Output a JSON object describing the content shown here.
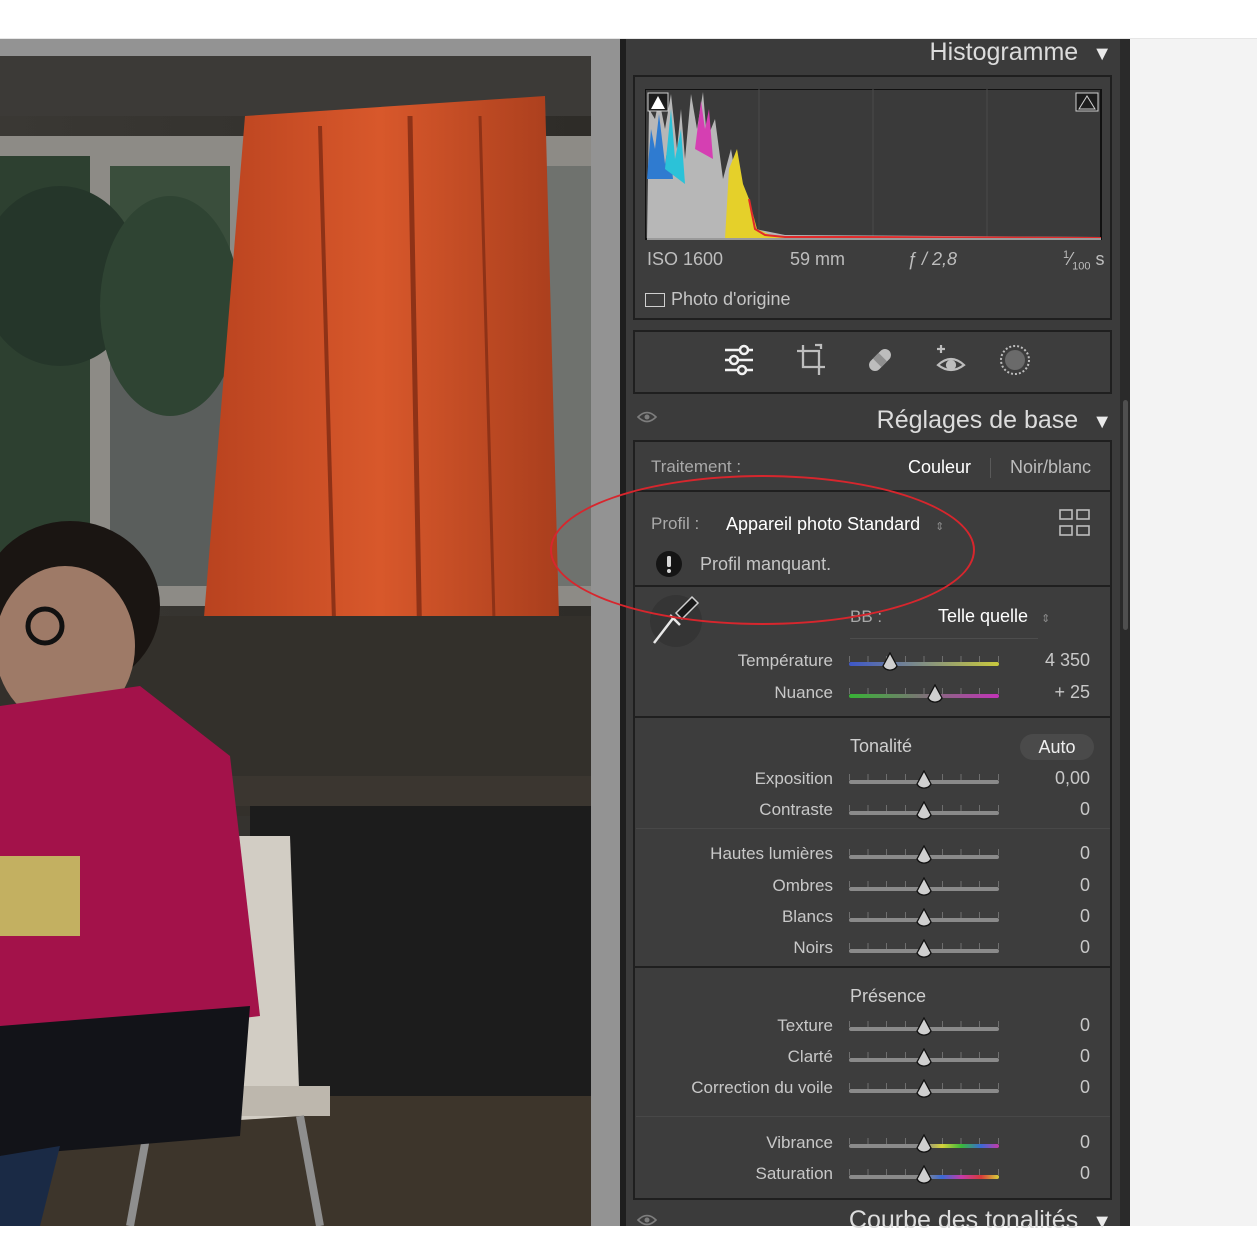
{
  "histogram": {
    "title": "Histogramme",
    "iso": "ISO 1600",
    "focal": "59 mm",
    "aperture": "ƒ / 2,8",
    "shutter_num": "1",
    "shutter_den": "100",
    "shutter_unit": "s",
    "original_photo_label": "Photo d'origine"
  },
  "tools": [
    {
      "name": "edit-sliders-icon"
    },
    {
      "name": "crop-icon"
    },
    {
      "name": "healing-icon"
    },
    {
      "name": "red-eye-icon"
    },
    {
      "name": "masking-icon"
    }
  ],
  "basic": {
    "title": "Réglages de base",
    "treatment_label": "Traitement :",
    "color_option": "Couleur",
    "bw_option": "Noir/blanc",
    "profile_label": "Profil :",
    "profile_value": "Appareil photo Standard",
    "profile_warning": "Profil manquant.",
    "wb_label": "BB :",
    "wb_value": "Telle quelle",
    "temp_label": "Température",
    "temp_value": "4 350",
    "tint_label": "Nuance",
    "tint_value": "+ 25",
    "tone_title": "Tonalité",
    "auto_label": "Auto",
    "exposure_label": "Exposition",
    "exposure_value": "0,00",
    "contrast_label": "Contraste",
    "contrast_value": "0",
    "highlights_label": "Hautes lumières",
    "highlights_value": "0",
    "shadows_label": "Ombres",
    "shadows_value": "0",
    "whites_label": "Blancs",
    "whites_value": "0",
    "blacks_label": "Noirs",
    "blacks_value": "0",
    "presence_title": "Présence",
    "texture_label": "Texture",
    "texture_value": "0",
    "clarity_label": "Clarté",
    "clarity_value": "0",
    "dehaze_label": "Correction du voile",
    "dehaze_value": "0",
    "vibrance_label": "Vibrance",
    "vibrance_value": "0",
    "saturation_label": "Saturation",
    "saturation_value": "0"
  },
  "next_panel": {
    "title": "Courbe des tonalités"
  },
  "colors": {
    "panel_bg": "#3b3b3b",
    "annotation_oval": "#d7262d"
  }
}
